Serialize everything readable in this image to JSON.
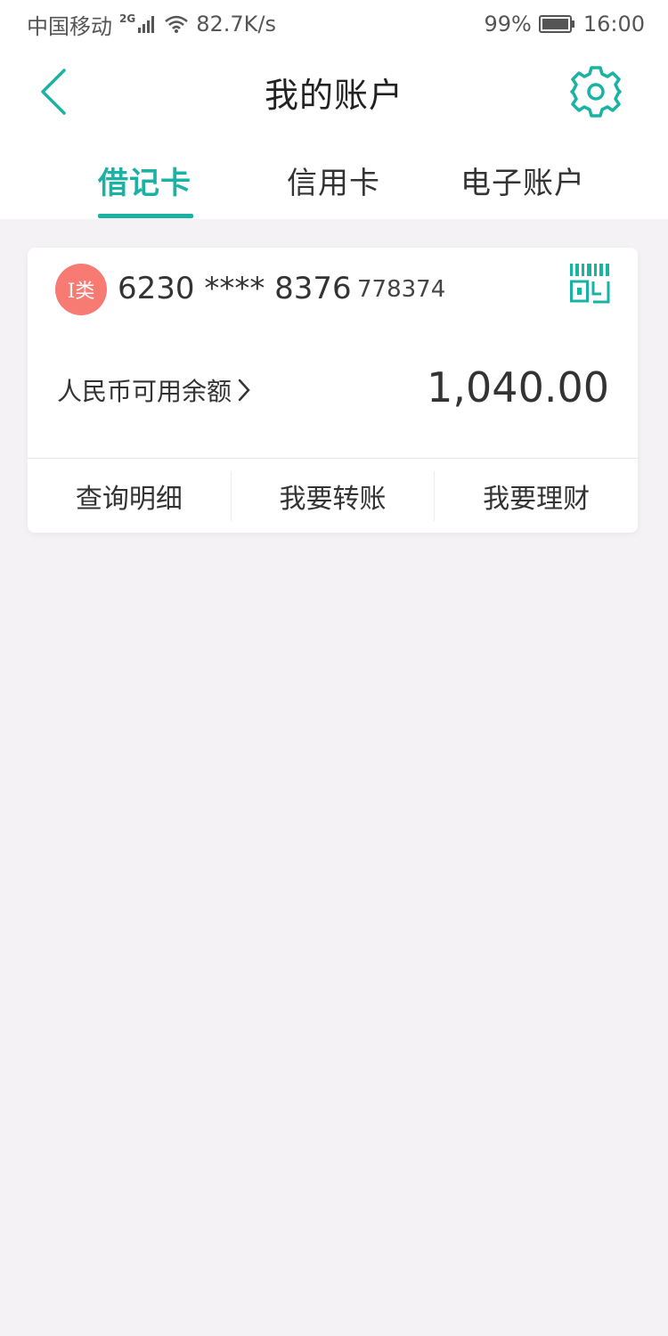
{
  "status_bar": {
    "carrier": "中国移动",
    "network": "2G",
    "speed": "82.7K/s",
    "battery": "99%",
    "time": "16:00"
  },
  "header": {
    "title": "我的账户",
    "back_icon": "chevron-left-icon",
    "settings_icon": "gear-icon"
  },
  "tabs": [
    {
      "label": "借记卡",
      "active": true
    },
    {
      "label": "信用卡",
      "active": false
    },
    {
      "label": "电子账户",
      "active": false
    }
  ],
  "card": {
    "badge": "I类",
    "number": "6230 **** 8376",
    "suffix": "778374",
    "qr_icon": "qr-code-icon",
    "balance_label": "人民币可用余额",
    "balance": "1,040.00",
    "actions": [
      "查询明细",
      "我要转账",
      "我要理财"
    ]
  },
  "colors": {
    "accent": "#1ab3a3",
    "badge": "#f77a73",
    "background": "#f5f2f5"
  }
}
